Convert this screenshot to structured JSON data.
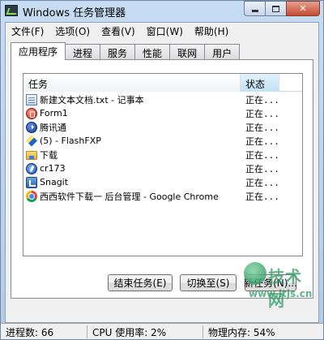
{
  "window": {
    "title": "Windows 任务管理器",
    "controls": {
      "minimize": "",
      "maximize": "",
      "close": "✕"
    }
  },
  "menubar": {
    "items": [
      "文件(F)",
      "选项(O)",
      "查看(V)",
      "窗口(W)",
      "帮助(H)"
    ]
  },
  "tabs": {
    "items": [
      "应用程序",
      "进程",
      "服务",
      "性能",
      "联网",
      "用户"
    ],
    "active": "应用程序"
  },
  "tasklist": {
    "columns": {
      "task": "任务",
      "status": "状态"
    },
    "sort_indicator": "^",
    "rows": [
      {
        "name": "新建文本文档.txt - 记事本",
        "status": "正在...",
        "icon": "notepad-icon"
      },
      {
        "name": "Form1",
        "status": "正在...",
        "icon": "form1-icon"
      },
      {
        "name": "腾讯通",
        "status": "正在...",
        "icon": "rtx-icon"
      },
      {
        "name": "(5) - FlashFXP",
        "status": "正在...",
        "icon": "flashfxp-icon"
      },
      {
        "name": "下载",
        "status": "正在...",
        "icon": "folder-icon"
      },
      {
        "name": "cr173",
        "status": "正在...",
        "icon": "cr173-icon"
      },
      {
        "name": "Snagit",
        "status": "正在...",
        "icon": "snagit-icon"
      },
      {
        "name": "西西软件下载一 后台管理 - Google Chrome",
        "status": "正在...",
        "icon": "chrome-icon"
      }
    ]
  },
  "buttons": {
    "end_task": "结束任务(E)",
    "switch_to": "切换至(S)",
    "new_task": "新任务(N)..."
  },
  "watermark": {
    "text": "技术网",
    "url": "www.itjs.cn"
  },
  "statusbar": {
    "processes": "进程数: 66",
    "cpu": "CPU 使用率: 2%",
    "memory": "物理内存: 54%"
  }
}
